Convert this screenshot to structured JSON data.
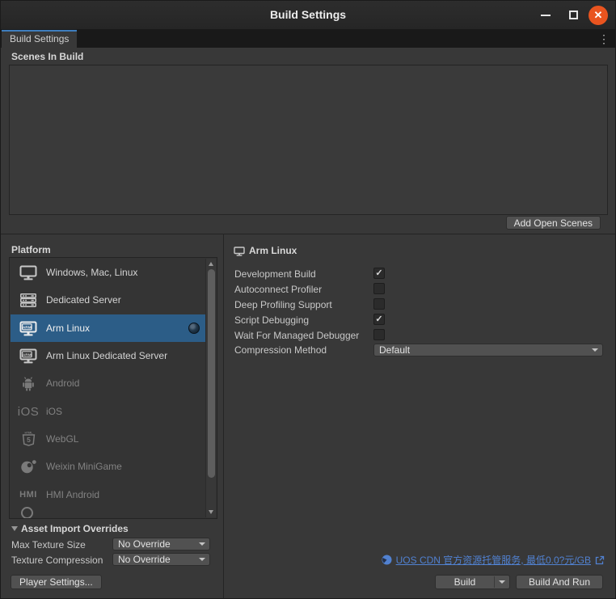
{
  "window": {
    "title": "Build Settings"
  },
  "icons": {
    "close": "✕",
    "kebab": "⋮",
    "check": "✓",
    "ios_glyph": "iOS",
    "hmi_glyph": "HMI",
    "arm_glyph": "ARM",
    "html5_number": "5",
    "html5_top": "HTML"
  },
  "tabbar": {
    "tab_label": "Build Settings"
  },
  "scenes": {
    "header": "Scenes In Build",
    "add_open_scenes_button": "Add Open Scenes"
  },
  "platform": {
    "header": "Platform",
    "items": [
      {
        "label": "Windows, Mac, Linux",
        "icon": "desktop-monitor-icon",
        "selected": false,
        "disabled": false
      },
      {
        "label": "Dedicated Server",
        "icon": "server-icon",
        "selected": false,
        "disabled": false
      },
      {
        "label": "Arm Linux",
        "icon": "arm-monitor-icon",
        "selected": true,
        "disabled": false,
        "badge": "unity-logo-badge"
      },
      {
        "label": "Arm Linux Dedicated Server",
        "icon": "arm-monitor-icon",
        "selected": false,
        "disabled": false
      },
      {
        "label": "Android",
        "icon": "android-icon",
        "selected": false,
        "disabled": true
      },
      {
        "label": "iOS",
        "icon": "ios-icon",
        "selected": false,
        "disabled": true
      },
      {
        "label": "WebGL",
        "icon": "html5-icon",
        "selected": false,
        "disabled": true
      },
      {
        "label": "Weixin MiniGame",
        "icon": "weixin-minigame-icon",
        "selected": false,
        "disabled": true
      },
      {
        "label": "HMI Android",
        "icon": "hmi-icon",
        "selected": false,
        "disabled": true
      }
    ]
  },
  "settings": {
    "header": "Arm Linux",
    "options": [
      {
        "label": "Development Build",
        "type": "checkbox",
        "checked": true
      },
      {
        "label": "Autoconnect Profiler",
        "type": "checkbox",
        "checked": false
      },
      {
        "label": "Deep Profiling Support",
        "type": "checkbox",
        "checked": false
      },
      {
        "label": "Script Debugging",
        "type": "checkbox",
        "checked": true
      },
      {
        "label": "Wait For Managed Debugger",
        "type": "checkbox",
        "checked": false
      },
      {
        "label": "Compression Method",
        "type": "dropdown",
        "value": "Default"
      }
    ]
  },
  "asset_import_overrides": {
    "header": "Asset Import Overrides",
    "rows": [
      {
        "label": "Max Texture Size",
        "value": "No Override"
      },
      {
        "label": "Texture Compression",
        "value": "No Override"
      }
    ]
  },
  "footer": {
    "player_settings_button": "Player Settings...",
    "uos_link": "UOS CDN 官方资源托管服务, 最低0.0?元/GB",
    "build_button": "Build",
    "build_and_run_button": "Build And Run"
  },
  "colors": {
    "selection_blue": "#2C5D87",
    "tab_accent_blue": "#3E7DBD",
    "link_blue": "#5181D0",
    "close_button_orange": "#E9541F",
    "window_bg": "#383838"
  }
}
